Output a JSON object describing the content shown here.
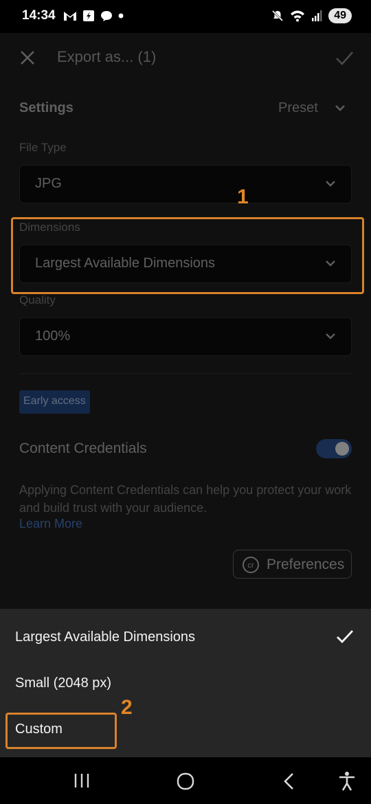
{
  "status_bar": {
    "time": "14:34",
    "battery": "49",
    "left_icons": [
      "gmail-icon",
      "app-icon",
      "chat-icon",
      "dot-icon"
    ],
    "right_icons": [
      "mute-icon",
      "wifi-icon",
      "signal-icon"
    ]
  },
  "top_bar": {
    "title": "Export as... (1)",
    "close_icon": "close-icon",
    "confirm_icon": "check-icon"
  },
  "settings": {
    "title": "Settings",
    "preset_label": "Preset"
  },
  "file_type": {
    "label": "File Type",
    "value": "JPG"
  },
  "dimensions": {
    "label": "Dimensions",
    "value": "Largest Available Dimensions"
  },
  "quality": {
    "label": "Quality",
    "value": "100%"
  },
  "early_access": "Early access",
  "content_credentials": {
    "label": "Content Credentials",
    "enabled": true,
    "description": "Applying Content Credentials can help you protect your work and build trust with your audience.",
    "learn_more": "Learn More",
    "preferences_label": "Preferences"
  },
  "dimension_options": [
    {
      "label": "Largest Available Dimensions",
      "selected": true
    },
    {
      "label": "Small (2048 px)",
      "selected": false
    },
    {
      "label": "Custom",
      "selected": false
    }
  ],
  "annotations": {
    "step1": "1",
    "step2": "2",
    "color": "#d9822b"
  },
  "nav_bar": {
    "icons": [
      "recent-apps-icon",
      "home-icon",
      "back-icon",
      "accessibility-icon"
    ]
  },
  "colors": {
    "background": "#1a1a1a",
    "sheet": "#262626",
    "accent_blue": "#3c6bb0",
    "badge_bg": "#1f3f74"
  }
}
